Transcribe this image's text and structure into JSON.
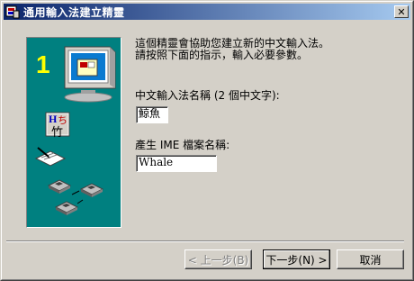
{
  "window": {
    "title": "通用輸入法建立精靈",
    "close_label": "✕"
  },
  "panel": {
    "step_number": "1",
    "glyph_top": "H",
    "glyph_accent": "ち",
    "glyph_bottom": "竹"
  },
  "intro": {
    "line1": "這個精靈會協助您建立新的中文輸入法。",
    "line2": "請按照下面的指示，輸入必要參數。"
  },
  "name_field": {
    "label": "中文輸入法名稱 (2 個中文字):",
    "value": "鯨魚"
  },
  "file_field": {
    "label": "產生  IME 檔案名稱:",
    "value": "Whale"
  },
  "buttons": {
    "back": "< 上一步(B)",
    "next": "下一步(N) >",
    "cancel": "取消"
  },
  "colors": {
    "title_gradient_start": "#0a246a",
    "title_gradient_end": "#a6caf0",
    "panel": "#008080",
    "step_number": "#ffff00",
    "face": "#d4d0c8"
  }
}
